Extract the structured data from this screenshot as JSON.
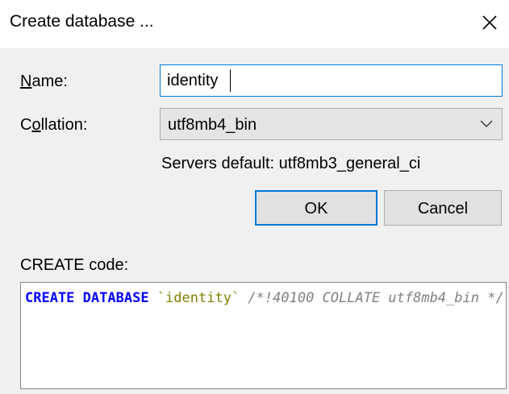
{
  "window": {
    "title": "Create database ...",
    "close_icon": "close-icon"
  },
  "form": {
    "name_label_mnemonic": "N",
    "name_label_rest": "ame:",
    "name_value": "identity",
    "collation_label_first": "C",
    "collation_label_mnemonic": "o",
    "collation_label_rest": "llation:",
    "collation_value": "utf8mb4_bin",
    "collation_dropdown_icon": "chevron-down-icon",
    "servers_default": "Servers default: utf8mb3_general_ci"
  },
  "buttons": {
    "ok_label": "OK",
    "cancel_label": "Cancel"
  },
  "code": {
    "label": "CREATE code:",
    "keyword_create": "CREATE",
    "space1": " ",
    "keyword_database": "DATABASE",
    "space2": " ",
    "identifier": "`identity`",
    "space3": " ",
    "comment": "/*!40100 COLLATE utf8mb4_bin */"
  },
  "colors": {
    "focus_border": "#0078d7",
    "keyword": "#0000ff",
    "identifier": "#808000",
    "comment": "#808080",
    "dialog_background": "#f0f0f0"
  }
}
